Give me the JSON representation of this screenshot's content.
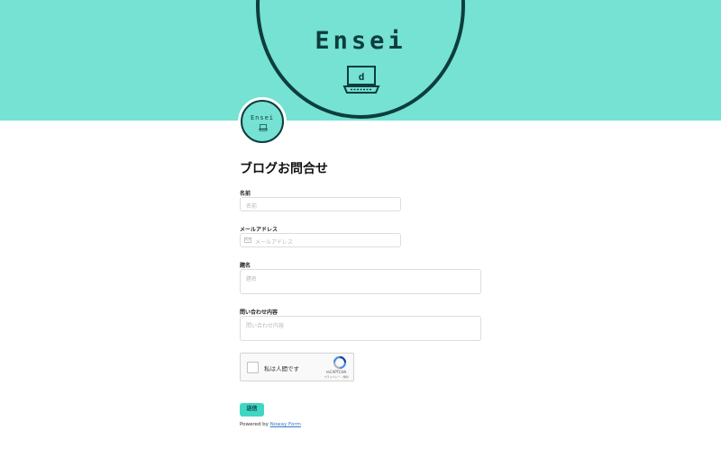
{
  "banner": {
    "title": "Ensei"
  },
  "avatar": {
    "title": "Ensei"
  },
  "form": {
    "title": "ブログお問合せ",
    "fields": [
      {
        "label": "名前",
        "placeholder": "名前"
      },
      {
        "label": "メールアドレス",
        "placeholder": "メールアドレス"
      },
      {
        "label": "題名",
        "placeholder": "題名"
      },
      {
        "label": "問い合わせ内容",
        "placeholder": "問い合わせ内容"
      }
    ],
    "recaptcha": {
      "label": "私は人間です",
      "brand": "reCAPTCHA",
      "links": "プライバシー - 規約"
    },
    "submit_label": "送信",
    "powered_by": {
      "prefix": "Powered by ",
      "link": "Noway Form"
    }
  },
  "colors": {
    "accent": "#75e2d3",
    "dark": "#0e3d3e",
    "button": "#3fd6c4"
  }
}
